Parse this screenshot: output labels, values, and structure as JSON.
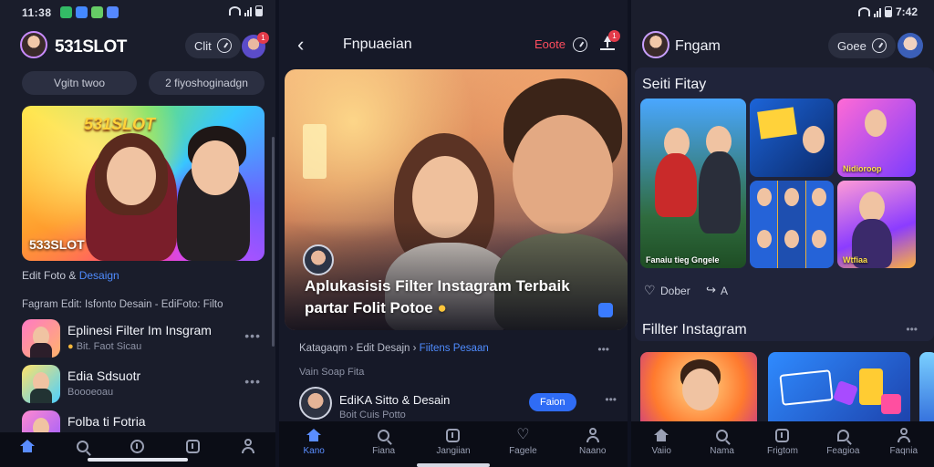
{
  "left": {
    "status": {
      "time": "11:38"
    },
    "brand": "531SLOT",
    "header_pill": "Clit",
    "badge": "1",
    "chips": [
      "Vgitn twoo",
      "2 fiyoshoginadgn"
    ],
    "hero_brand": "531SLOT",
    "hero_logo": "533SLOT",
    "section_label": "Edit Foto & ",
    "section_label_accent": "Desaign",
    "subsection_label": "Fagram Edit: Isfonto Desain - EdiFoto: Filto",
    "items": [
      {
        "title": "Eplinesi Filter Im Insgram",
        "subtitle": "Bit. Faot Sicau"
      },
      {
        "title": "Edia Sdsuotr",
        "subtitle": "Boooeoau"
      },
      {
        "title": "Folba ti Fotria",
        "subtitle": ""
      }
    ],
    "more": "•••"
  },
  "middle": {
    "title": "Fnpuaeian",
    "action": "Eoote",
    "badge": "1",
    "hero_title": "Aplukasisis Filter Instagram Terbaik partar Folit Potoe",
    "crumb_a": "Katagaqm › Edit Desajn › ",
    "crumb_b": "Fiitens Pesaan",
    "small_label": "Vain Soap Fita",
    "author_title": "EdiKA Sitto & Desain",
    "author_sub": "Boit Cuis Potto",
    "follow_label": "Faion",
    "more": "•••",
    "nav": [
      "Kano",
      "Fiana",
      "Jangiian",
      "Fagele",
      "Naano"
    ]
  },
  "right": {
    "status": {
      "time": "7:42"
    },
    "title": "Fngam",
    "header_pill": "Goee",
    "section1": "Seiti Fitay",
    "tile_caps": [
      "Fanaiu tieg Gngele",
      "",
      "Nidioroop",
      "",
      "Wtfiaa"
    ],
    "like_label": "Dober",
    "share_label": "A",
    "section2": "Fillter Instagram",
    "more": "•••",
    "nav": [
      "Vaiio",
      "Nama",
      "Frigtom",
      "Feagioa",
      "Faqnia"
    ]
  },
  "colors": {
    "accent": "#4f8cff",
    "alert": "#e33b4a",
    "bg": "#1a1d2b"
  }
}
